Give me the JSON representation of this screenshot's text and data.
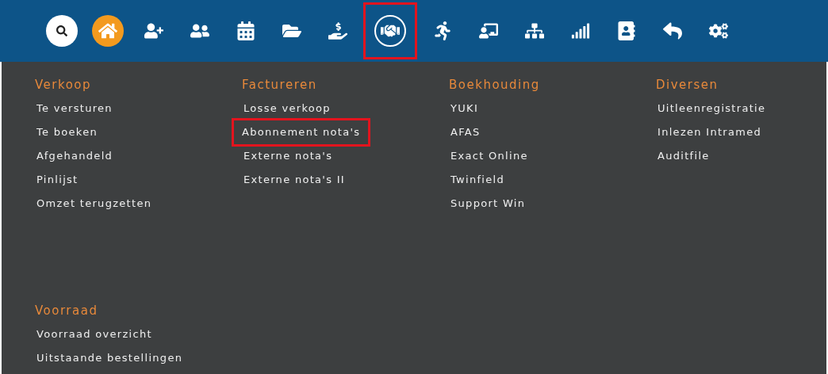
{
  "toolbar": {
    "items": [
      {
        "kind": "search",
        "active": false,
        "highlighted": false
      },
      {
        "kind": "home",
        "active": true,
        "highlighted": false
      },
      {
        "kind": "user-add",
        "active": false,
        "highlighted": false
      },
      {
        "kind": "users",
        "active": false,
        "highlighted": false
      },
      {
        "kind": "calendar",
        "active": false,
        "highlighted": false
      },
      {
        "kind": "folder",
        "active": false,
        "highlighted": false
      },
      {
        "kind": "money-hand",
        "active": false,
        "highlighted": false
      },
      {
        "kind": "handshake",
        "active": false,
        "highlighted": true
      },
      {
        "kind": "stretch",
        "active": false,
        "highlighted": false
      },
      {
        "kind": "desk",
        "active": false,
        "highlighted": false
      },
      {
        "kind": "org",
        "active": false,
        "highlighted": false
      },
      {
        "kind": "chart",
        "active": false,
        "highlighted": false
      },
      {
        "kind": "contacts",
        "active": false,
        "highlighted": false
      },
      {
        "kind": "reply",
        "active": false,
        "highlighted": false
      },
      {
        "kind": "settings",
        "active": false,
        "highlighted": false
      }
    ]
  },
  "menu": {
    "sections": [
      {
        "title": "Verkoop",
        "items": [
          {
            "label": "Te versturen",
            "highlighted": false
          },
          {
            "label": "Te boeken",
            "highlighted": false
          },
          {
            "label": "Afgehandeld",
            "highlighted": false
          },
          {
            "label": "Pinlijst",
            "highlighted": false
          },
          {
            "label": "Omzet terugzetten",
            "highlighted": false
          }
        ]
      },
      {
        "title": "Factureren",
        "items": [
          {
            "label": "Losse verkoop",
            "highlighted": false
          },
          {
            "label": "Abonnement nota's",
            "highlighted": true
          },
          {
            "label": "Externe nota's",
            "highlighted": false
          },
          {
            "label": "Externe nota's II",
            "highlighted": false
          }
        ]
      },
      {
        "title": "Boekhouding",
        "items": [
          {
            "label": "YUKI",
            "highlighted": false
          },
          {
            "label": "AFAS",
            "highlighted": false
          },
          {
            "label": "Exact Online",
            "highlighted": false
          },
          {
            "label": "Twinfield",
            "highlighted": false
          },
          {
            "label": "Support Win",
            "highlighted": false
          }
        ]
      },
      {
        "title": "Diversen",
        "items": [
          {
            "label": "Uitleenregistratie",
            "highlighted": false
          },
          {
            "label": "Inlezen Intramed",
            "highlighted": false
          },
          {
            "label": "Auditfile",
            "highlighted": false
          }
        ]
      },
      {
        "title": "Voorraad",
        "items": [
          {
            "label": "Voorraad overzicht",
            "highlighted": false
          },
          {
            "label": "Uitstaande bestellingen",
            "highlighted": false
          }
        ]
      }
    ]
  }
}
